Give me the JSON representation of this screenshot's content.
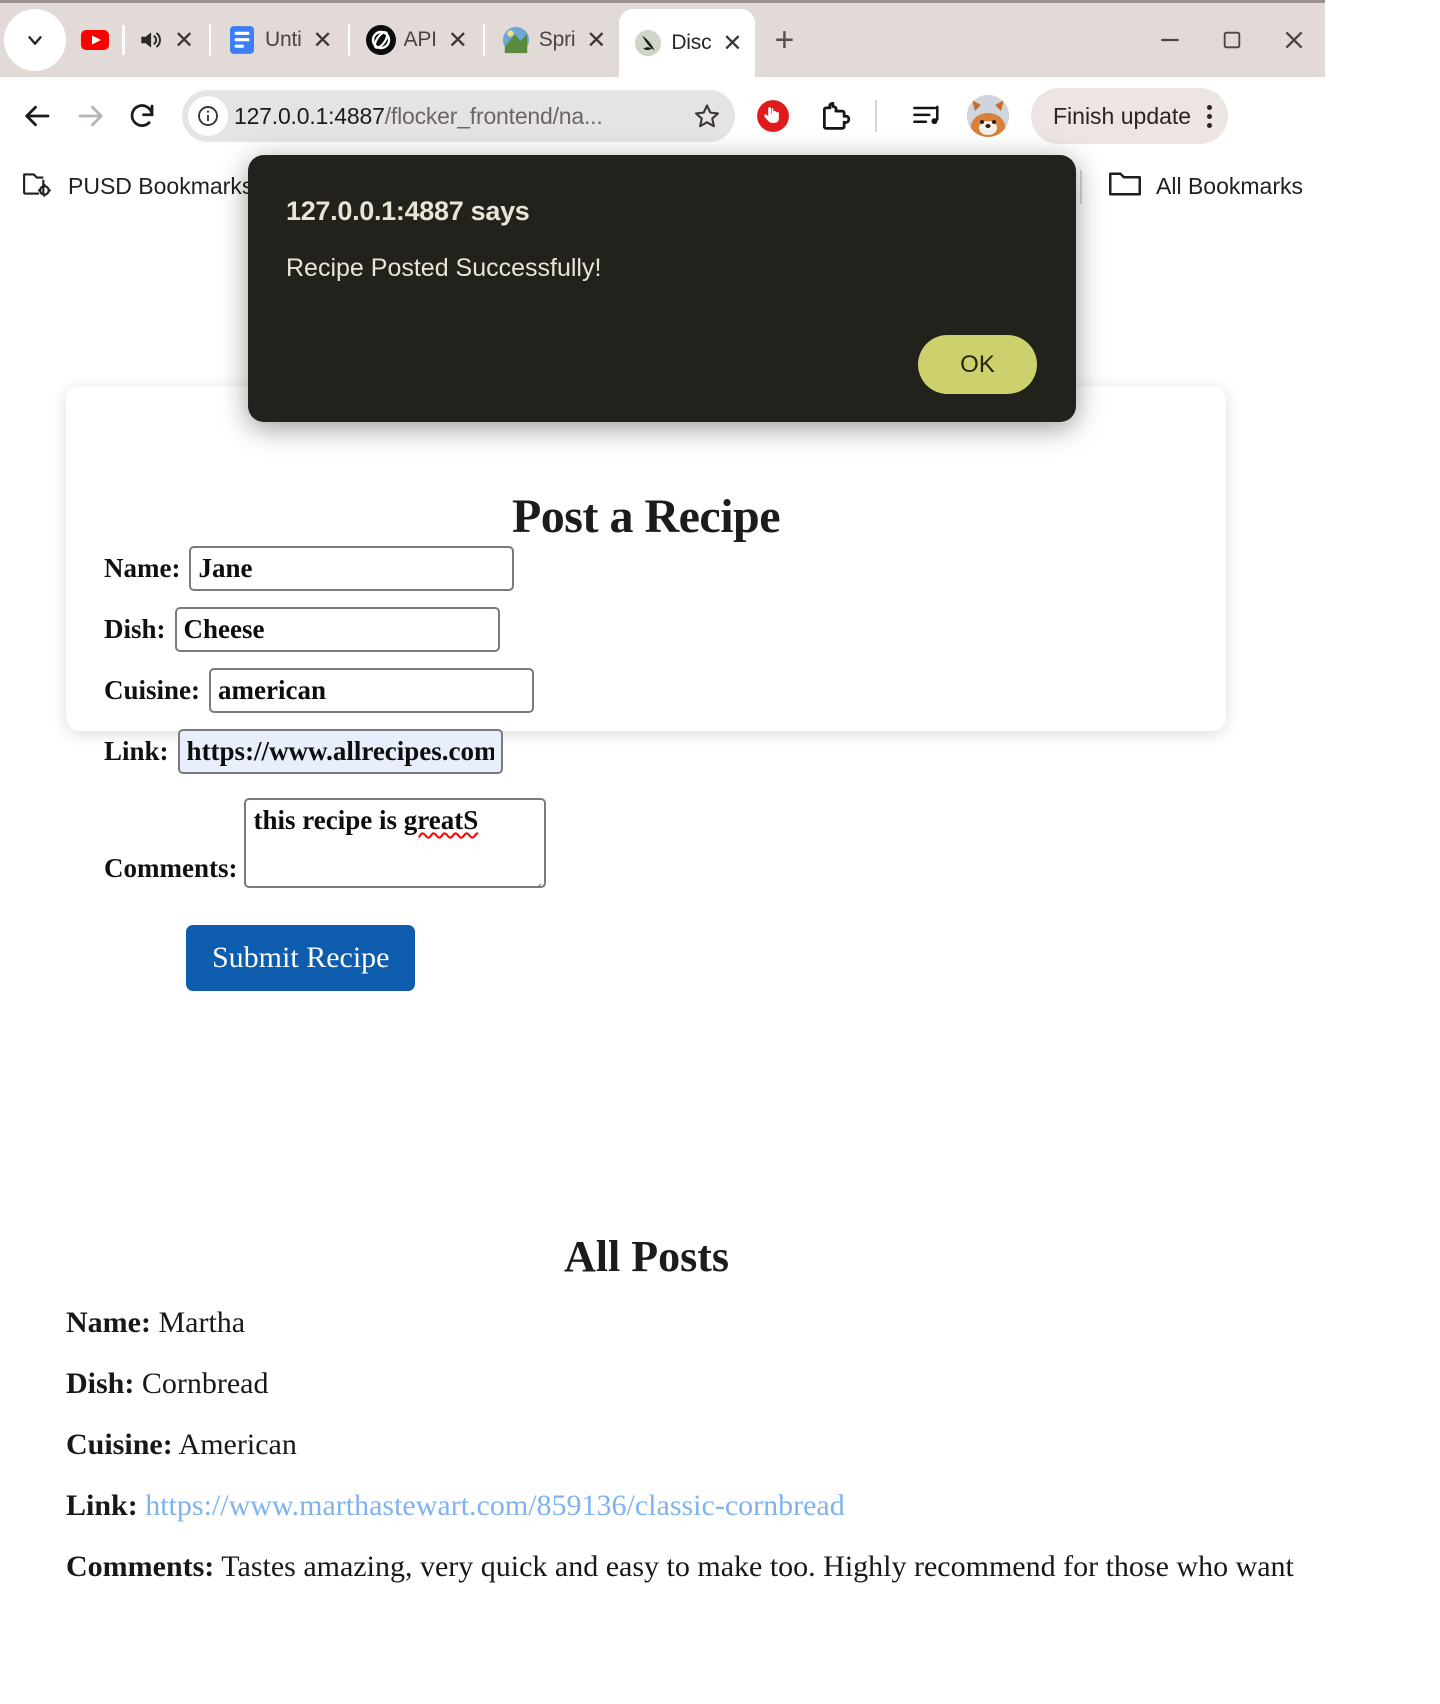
{
  "browser": {
    "tabs": [
      {
        "title": "",
        "icon": "youtube-icon",
        "muted_icon": "speaker-icon",
        "active": false
      },
      {
        "title": "Unti",
        "icon": "docs-icon",
        "active": false
      },
      {
        "title": "API",
        "icon": "openai-icon",
        "active": false
      },
      {
        "title": "Spri",
        "icon": "spring-icon",
        "active": false
      },
      {
        "title": "Disc",
        "icon": "discord-icon",
        "active": true
      }
    ],
    "close_label": "✕",
    "newtab_label": "+",
    "window_controls": {
      "minimize": "—",
      "maximize": "☐",
      "close": "✕"
    },
    "nav": {
      "back": "back-arrow",
      "forward": "forward-arrow",
      "reload": "reload-icon"
    },
    "omnibox": {
      "info_icon": "info-circle-icon",
      "url_visible": "127.0.0.1:4887",
      "url_path": "/flocker_frontend/na...",
      "star_icon": "star-icon"
    },
    "extensions": [
      "adblock-icon",
      "puzzle-extension-icon",
      "music-list-icon"
    ],
    "profile": {
      "avatar": "fox-avatar"
    },
    "update": {
      "label": "Finish update",
      "menu": "kebab-menu-icon"
    },
    "bookmarks": {
      "left": {
        "label": "PUSD Bookmarks",
        "icon": "folder-gear-icon"
      },
      "right": {
        "label": "All Bookmarks",
        "icon": "folder-icon"
      }
    }
  },
  "dialog": {
    "origin": "127.0.0.1:4887 says",
    "message": "Recipe Posted Successfully!",
    "ok_label": "OK",
    "ok_color": "#ccd16d",
    "bg_color": "#22211b"
  },
  "form": {
    "title": "Post a Recipe",
    "fields": [
      {
        "label": "Name:",
        "value": "Jane",
        "autofill": false
      },
      {
        "label": "Dish:",
        "value": "Cheese",
        "autofill": false
      },
      {
        "label": "Cuisine:",
        "value": "american",
        "autofill": false
      },
      {
        "label": "Link:",
        "value": "https://www.allrecipes.com/r",
        "autofill": true
      }
    ],
    "comments": {
      "label": "Comments:",
      "value_ok": "this recipe is ",
      "value_misspelled": "greatS"
    },
    "submit": {
      "label": "Submit Recipe",
      "color": "#0d5cad"
    }
  },
  "posts": {
    "heading": "All Posts",
    "items": [
      {
        "name_label": "Name:",
        "name": "Martha",
        "dish_label": "Dish:",
        "dish": "Cornbread",
        "cuisine_label": "Cuisine:",
        "cuisine": "American",
        "link_label": "Link:",
        "link": "https://www.marthastewart.com/859136/classic-cornbread",
        "comments_label": "Comments:",
        "comments": "Tastes amazing, very quick and easy to make too. Highly recommend for those who want to make"
      }
    ]
  }
}
